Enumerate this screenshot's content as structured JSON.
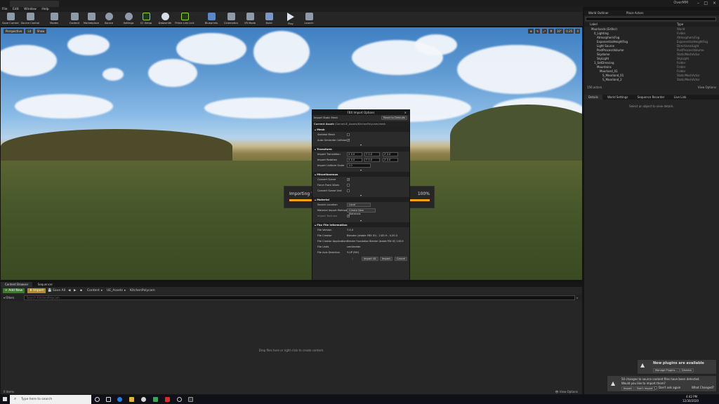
{
  "window": {
    "project_name": "OverMM",
    "title_tab": ""
  },
  "menu": [
    "File",
    "Edit",
    "Window",
    "Help"
  ],
  "toolbar": [
    "Save Current",
    "Source Control",
    "Modes",
    "Content",
    "Marketplace",
    "Source",
    "Settings",
    "CC Setup",
    "Datasmith",
    "Prime Link Link",
    "Blueprints",
    "Cinematics",
    "VR Mode",
    "Build",
    "Play",
    "Launch"
  ],
  "viewport": {
    "buttons": [
      "Perspective",
      "Lit",
      "Show"
    ],
    "right": [
      "10°",
      "0.25",
      "4"
    ]
  },
  "progress": {
    "text": "Importing \"r",
    "percent": "100%",
    "fraction": 1.0
  },
  "import_dialog": {
    "title": "FBX Import Options",
    "import_type": "Import Static Mesh",
    "reset": "Reset to Defaults",
    "current_asset_label": "Current Asset:",
    "current_asset": "/Game/UE_Assets/KitchenPolycam/mesh",
    "sections": {
      "mesh": {
        "title": "Mesh",
        "rows": [
          {
            "label": "Skeletal Mesh",
            "checked": false
          },
          {
            "label": "Auto Generate Collision",
            "checked": true
          }
        ]
      },
      "transform": {
        "title": "Transform",
        "rows": [
          {
            "label": "Import Translation",
            "values": [
              "X 0.0",
              "Y 0.0",
              "Z 0.0"
            ]
          },
          {
            "label": "Import Rotation",
            "values": [
              "X 0.0",
              "Y 0.0",
              "Z 0.0"
            ]
          },
          {
            "label": "Import Uniform Scale",
            "values": [
              "1.0"
            ]
          }
        ]
      },
      "misc": {
        "title": "Miscellaneous",
        "rows": [
          {
            "label": "Convert Scene",
            "checked": true
          },
          {
            "label": "Force Front XAxis",
            "checked": false
          },
          {
            "label": "Convert Scene Unit",
            "checked": false
          }
        ]
      },
      "material": {
        "title": "Material",
        "rows": [
          {
            "label": "Search Location",
            "value": "Local"
          },
          {
            "label": "Material Import Method",
            "value": "Create New Materials"
          },
          {
            "label": "Import Textures",
            "checked": true
          }
        ]
      },
      "fbx_info": {
        "title": "Fbx File Information",
        "rows": [
          {
            "label": "File Version",
            "value": "7.4.0"
          },
          {
            "label": "File Creator",
            "value": "Blender (stable FBX IO) - 2.83.9 - 4.20.3"
          },
          {
            "label": "File Creator Application",
            "value": "Blender Foundation Blender (stable FBX IO) 2.83.9"
          },
          {
            "label": "File Units",
            "value": "centimeter"
          },
          {
            "label": "File Axis Direction",
            "value": "Y-UP (RH)"
          }
        ]
      }
    },
    "buttons": {
      "import_all": "Import All",
      "import": "Import",
      "cancel": "Cancel"
    }
  },
  "content_browser": {
    "tabs": [
      "Content Browser",
      "Sequencer"
    ],
    "add_new": "Add New",
    "import": "Import",
    "save_all": "Save All",
    "path": [
      "Content",
      "UE_Assets",
      "KitchenPolycam"
    ],
    "filters": "Filters",
    "search_placeholder": "Search KitchenPolycam",
    "empty": "Drop files here or right click to create content.",
    "items": "0 items",
    "view_options": "View Options"
  },
  "outliner": {
    "tabs": [
      "World Outliner",
      "Place Actors"
    ],
    "columns": [
      "Label",
      "Type"
    ],
    "rows": [
      {
        "label": "Moorlands (Editor)",
        "type": "World"
      },
      {
        "label": "0_Lighting",
        "type": "Folder"
      },
      {
        "label": "AtmosphericFog",
        "type": "AtmosphericFog"
      },
      {
        "label": "ExponentialHeightFog",
        "type": "ExponentialHeightFog"
      },
      {
        "label": "Light Source",
        "type": "DirectionalLight"
      },
      {
        "label": "PostProcessVolume",
        "type": "PostProcessVolume"
      },
      {
        "label": "Skydome",
        "type": "StaticMeshActor"
      },
      {
        "label": "SkyLight",
        "type": "SkyLight"
      },
      {
        "label": "1_SetDressing",
        "type": "Folder"
      },
      {
        "label": "Mountains",
        "type": "Folder"
      },
      {
        "label": "Moorland_01",
        "type": "Folder"
      },
      {
        "label": "S_Moorland_01",
        "type": "StaticMeshActor"
      },
      {
        "label": "S_Moorland_2",
        "type": "StaticMeshActor"
      }
    ],
    "count": "156 actors",
    "view_options": "View Options"
  },
  "details": {
    "tabs": [
      "Details",
      "World Settings",
      "Sequence Recorder",
      "Live Link"
    ],
    "empty": "Select an object to view details."
  },
  "notifications": {
    "plugins": {
      "title": "New plugins are available",
      "manage": "Manage Plugins...",
      "dismiss": "Dismiss"
    },
    "source": {
      "text1": "50 changes to source content files have been detected.",
      "text2": "Would you like to import them?",
      "import": "Import",
      "dont_import": "Don't Import",
      "dont_ask": "Don't ask again",
      "what_changed": "What Changed?"
    }
  },
  "taskbar": {
    "search": "Type here to search",
    "time": "4:42 PM",
    "date": "12/30/2020"
  }
}
